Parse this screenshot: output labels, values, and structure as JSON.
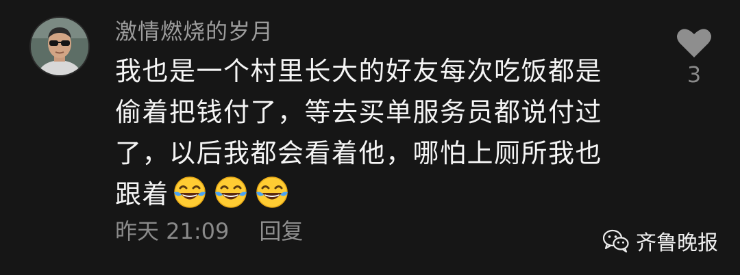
{
  "comment": {
    "username": "激情燃烧的岁月",
    "lines": [
      "我也是一个村里长大的好友每次吃饭都是",
      "偷着把钱付了，等去买单服务员都说付过",
      "了，以后我都会看着他，哪怕上厕所我也",
      "跟着"
    ],
    "emoji": [
      "laughing-crying-emoji",
      "laughing-crying-emoji",
      "laughing-crying-emoji"
    ],
    "time": "昨天 21:09",
    "reply_label": "回复",
    "like_count": "3"
  },
  "watermark": {
    "label": "齐鲁晚报",
    "icon": "wechat-icon"
  },
  "colors": {
    "background": "#161616",
    "text": "#f5f5f5",
    "muted": "#8a8a8a",
    "heart": "#8e8e8e",
    "emoji": "#ffcc33",
    "tears": "#4aa3f5"
  }
}
